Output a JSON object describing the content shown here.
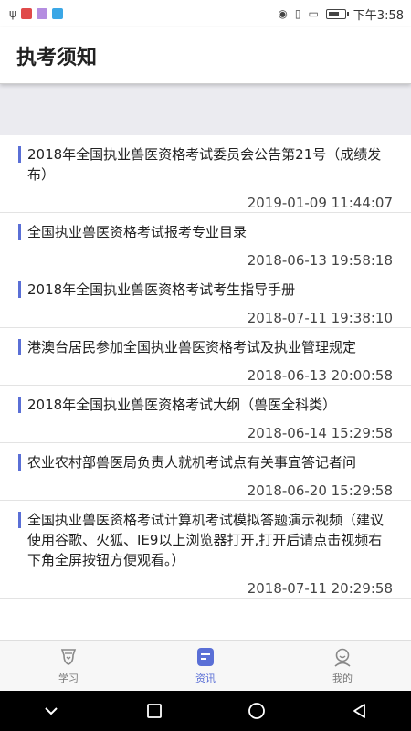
{
  "status_bar": {
    "time": "下午3:58",
    "left_icons": [
      "usb-icon",
      "app-notification-icon",
      "app-notification-icon",
      "app-notification-icon"
    ],
    "right_icons": [
      "eye-icon",
      "vibrate-icon",
      "sim-icon",
      "battery-icon"
    ]
  },
  "header": {
    "title": "执考须知"
  },
  "news": [
    {
      "title": "2018年全国执业兽医资格考试委员会公告第21号（成绩发布）",
      "date": "2019-01-09 11:44:07"
    },
    {
      "title": "全国执业兽医资格考试报考专业目录",
      "date": "2018-06-13 19:58:18"
    },
    {
      "title": "2018年全国执业兽医资格考试考生指导手册",
      "date": "2018-07-11 19:38:10"
    },
    {
      "title": "港澳台居民参加全国执业兽医资格考试及执业管理规定",
      "date": "2018-06-13 20:00:58"
    },
    {
      "title": "2018年全国执业兽医资格考试大纲（兽医全科类）",
      "date": "2018-06-14 15:29:58"
    },
    {
      "title": "农业农村部兽医局负责人就机考试点有关事宜答记者问",
      "date": "2018-06-20 15:29:58"
    },
    {
      "title": "全国执业兽医资格考试计算机考试模拟答题演示视频（建议使用谷歌、火狐、IE9以上浏览器打开,打开后请点击视频右下角全屏按钮方便观看。）",
      "date": "2018-07-11 20:29:58"
    }
  ],
  "tabs": [
    {
      "label": "学习",
      "icon": "study-icon",
      "active": false
    },
    {
      "label": "资讯",
      "icon": "news-icon",
      "active": true
    },
    {
      "label": "我的",
      "icon": "profile-icon",
      "active": false
    }
  ],
  "nav": [
    "chevron-down-icon",
    "recent-apps-icon",
    "home-icon",
    "back-icon"
  ],
  "colors": {
    "accent": "#5a6fd6",
    "divider": "#e3e3e3",
    "banner_bg": "#ebebf0"
  }
}
